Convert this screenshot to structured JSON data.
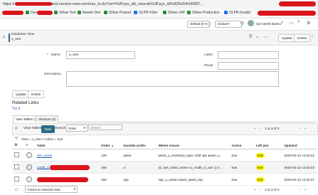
{
  "browser": {
    "url_prefix": "https://",
    "url_suffix": "test.service-now.com/nav_to.do?uri=%2Fsys_db_view.do%3Fsys_id%3D6e54c06087...",
    "bookmarks": [
      {
        "label": "Dev"
      },
      {
        "label": "SNow Test"
      },
      {
        "label": "Master Dev"
      },
      {
        "label": "SNow Prepod"
      },
      {
        "label": "OLPR-Filter"
      },
      {
        "label": "SNow UAT"
      },
      {
        "label": "SNow Production"
      },
      {
        "label": "OLPR-Invalid"
      }
    ]
  },
  "app_header": {
    "update_set": "Default [G",
    "scope": "Global",
    "user": "Sai Keerth Bachu"
  },
  "form_header": {
    "kicker": "Database View",
    "record": "u_test",
    "update_btn": "Update",
    "delete_btn": "Delete"
  },
  "form": {
    "name_label": "Name",
    "name_value": "u_test",
    "label_label": "Label",
    "plural_label": "Plural",
    "description_label": "Description",
    "update_btn": "Update",
    "delete_btn": "Delete"
  },
  "related": {
    "title": "Related Links",
    "try_it": "Try It",
    "tabs": [
      "View Tables (3)",
      "Versions (4)"
    ],
    "list_title": "View Tables",
    "new_btn": "New",
    "search_label": "Search",
    "search_field": "Order",
    "search_placeholder": "Search",
    "pager": "1   to 3 of 3",
    "breadcrumb": "View = u_test > Active = true"
  },
  "table": {
    "headers": [
      "Table",
      "Order",
      "Variable prefix",
      "Where clause",
      "Active",
      "Left join",
      "Updated"
    ],
    "rows": [
      {
        "table": "alm_asset",
        "order": "100",
        "prefix": "asset",
        "where": "asset_u_inventory_type='206' && asset_u...",
        "active": "true",
        "left_join": "true",
        "updated": "2023-04-13 14:53:22"
      },
      {
        "table": "cmdb_ci",
        "order": "200",
        "prefix": "ci",
        "where": "(ci_sys_class_name='u_cmdb_ci_vdc' || ci...",
        "active": "true",
        "left_join": "true",
        "updated": "2023-04-13 14:53:23"
      },
      {
        "table": "",
        "order": "450",
        "prefix": "sap",
        "where": "sap_u_asset=asset_asset_tag",
        "active": "true",
        "left_join": "true",
        "updated": "2023-04-13 14:32:37"
      }
    ]
  },
  "footer": {
    "actions": "Actions on selected rows...",
    "pager": "1   to 3 of 3"
  }
}
